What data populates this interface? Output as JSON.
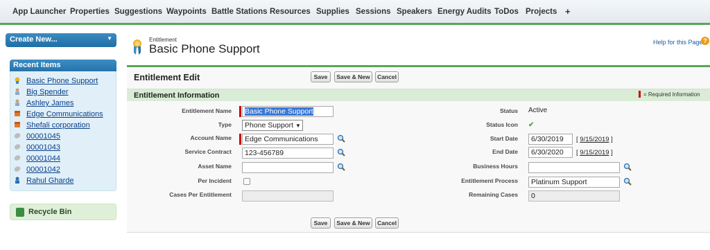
{
  "tabs": [
    "App Launcher",
    "Properties",
    "Suggestions",
    "Waypoints",
    "Battle Stations",
    "Resources",
    "Supplies",
    "Sessions",
    "Speakers",
    "Energy Audits",
    "ToDos",
    "Projects",
    "+"
  ],
  "sidebar": {
    "create_new_label": "Create New...",
    "recent_header": "Recent Items",
    "recent_items": [
      {
        "label": "Basic Phone Support",
        "icon": "entitlement-icon"
      },
      {
        "label": "Big Spender",
        "icon": "contact-icon"
      },
      {
        "label": "Ashley James",
        "icon": "contact-icon"
      },
      {
        "label": "Edge Communications",
        "icon": "account-icon"
      },
      {
        "label": "Shefali corporation",
        "icon": "account-icon"
      },
      {
        "label": "00001045",
        "icon": "case-icon"
      },
      {
        "label": "00001043",
        "icon": "case-icon"
      },
      {
        "label": "00001044",
        "icon": "case-icon"
      },
      {
        "label": "00001042",
        "icon": "case-icon"
      },
      {
        "label": "Rahul Gharde",
        "icon": "user-icon"
      }
    ],
    "recycle_bin_label": "Recycle Bin"
  },
  "header": {
    "object_type": "Entitlement",
    "record_title": "Basic Phone Support",
    "help_link": "Help for this Page"
  },
  "edit": {
    "title": "Entitlement Edit",
    "buttons": {
      "save": "Save",
      "save_new": "Save & New",
      "cancel": "Cancel"
    },
    "section_title": "Entitlement Information",
    "required_legend": "= Required Information"
  },
  "fields": {
    "entitlement_name_label": "Entitlement Name",
    "entitlement_name_value": "Basic Phone Support",
    "type_label": "Type",
    "type_value": "Phone Support",
    "account_name_label": "Account Name",
    "account_name_value": "Edge Communications",
    "service_contract_label": "Service Contract",
    "service_contract_value": "123-456789",
    "asset_name_label": "Asset Name",
    "asset_name_value": "",
    "per_incident_label": "Per Incident",
    "cases_per_entitlement_label": "Cases Per Entitlement",
    "status_label": "Status",
    "status_value": "Active",
    "status_icon_label": "Status Icon",
    "start_date_label": "Start Date",
    "start_date_value": "6/30/2019",
    "start_date_link": "9/15/2019",
    "end_date_label": "End Date",
    "end_date_value": "6/30/2020",
    "end_date_link": "9/15/2019",
    "business_hours_label": "Business Hours",
    "business_hours_value": "",
    "entitlement_process_label": "Entitlement Process",
    "entitlement_process_value": "Platinum Support",
    "remaining_cases_label": "Remaining Cases",
    "remaining_cases_value": "0"
  },
  "colors": {
    "accent_green": "#56a756",
    "link_blue": "#0a3f8a",
    "required_red": "#cc0000"
  }
}
